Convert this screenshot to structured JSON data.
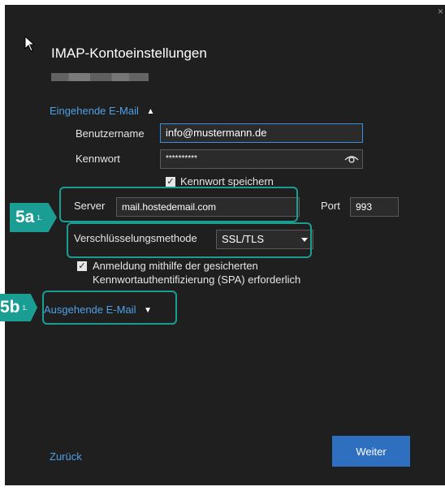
{
  "window": {
    "title": "IMAP-Kontoeinstellungen",
    "close_glyph": "×"
  },
  "incoming": {
    "section_label": "Eingehende E-Mail",
    "username_label": "Benutzername",
    "username_value": "info@mustermann.de",
    "password_label": "Kennwort",
    "password_value": "**********",
    "remember_label": "Kennwort speichern",
    "server_label": "Server",
    "server_value": "mail.hostedemail.com",
    "port_label": "Port",
    "port_value": "993",
    "encryption_label": "Verschlüsselungsmethode",
    "encryption_value": "SSL/TLS",
    "spa_label_line1": "Anmeldung mithilfe der gesicherten",
    "spa_label_line2": "Kennwortauthentifizierung (SPA) erforderlich"
  },
  "outgoing": {
    "section_label": "Ausgehende E-Mail"
  },
  "footer": {
    "back_label": "Zurück",
    "next_label": "Weiter"
  },
  "annotations": {
    "badge_5a": "5a",
    "badge_5b": "5b",
    "badge_suffix": "1."
  },
  "colors": {
    "background": "#1f1f1f",
    "link": "#4ea0e6",
    "primary_button": "#2f6fc0",
    "highlight": "#1a9e94"
  },
  "icons": {
    "cursor": "arrow-cursor-icon",
    "expand_up": "chevron-up-icon",
    "expand_down": "chevron-down-icon",
    "reveal_password": "eye-icon",
    "dropdown": "caret-down-icon"
  }
}
